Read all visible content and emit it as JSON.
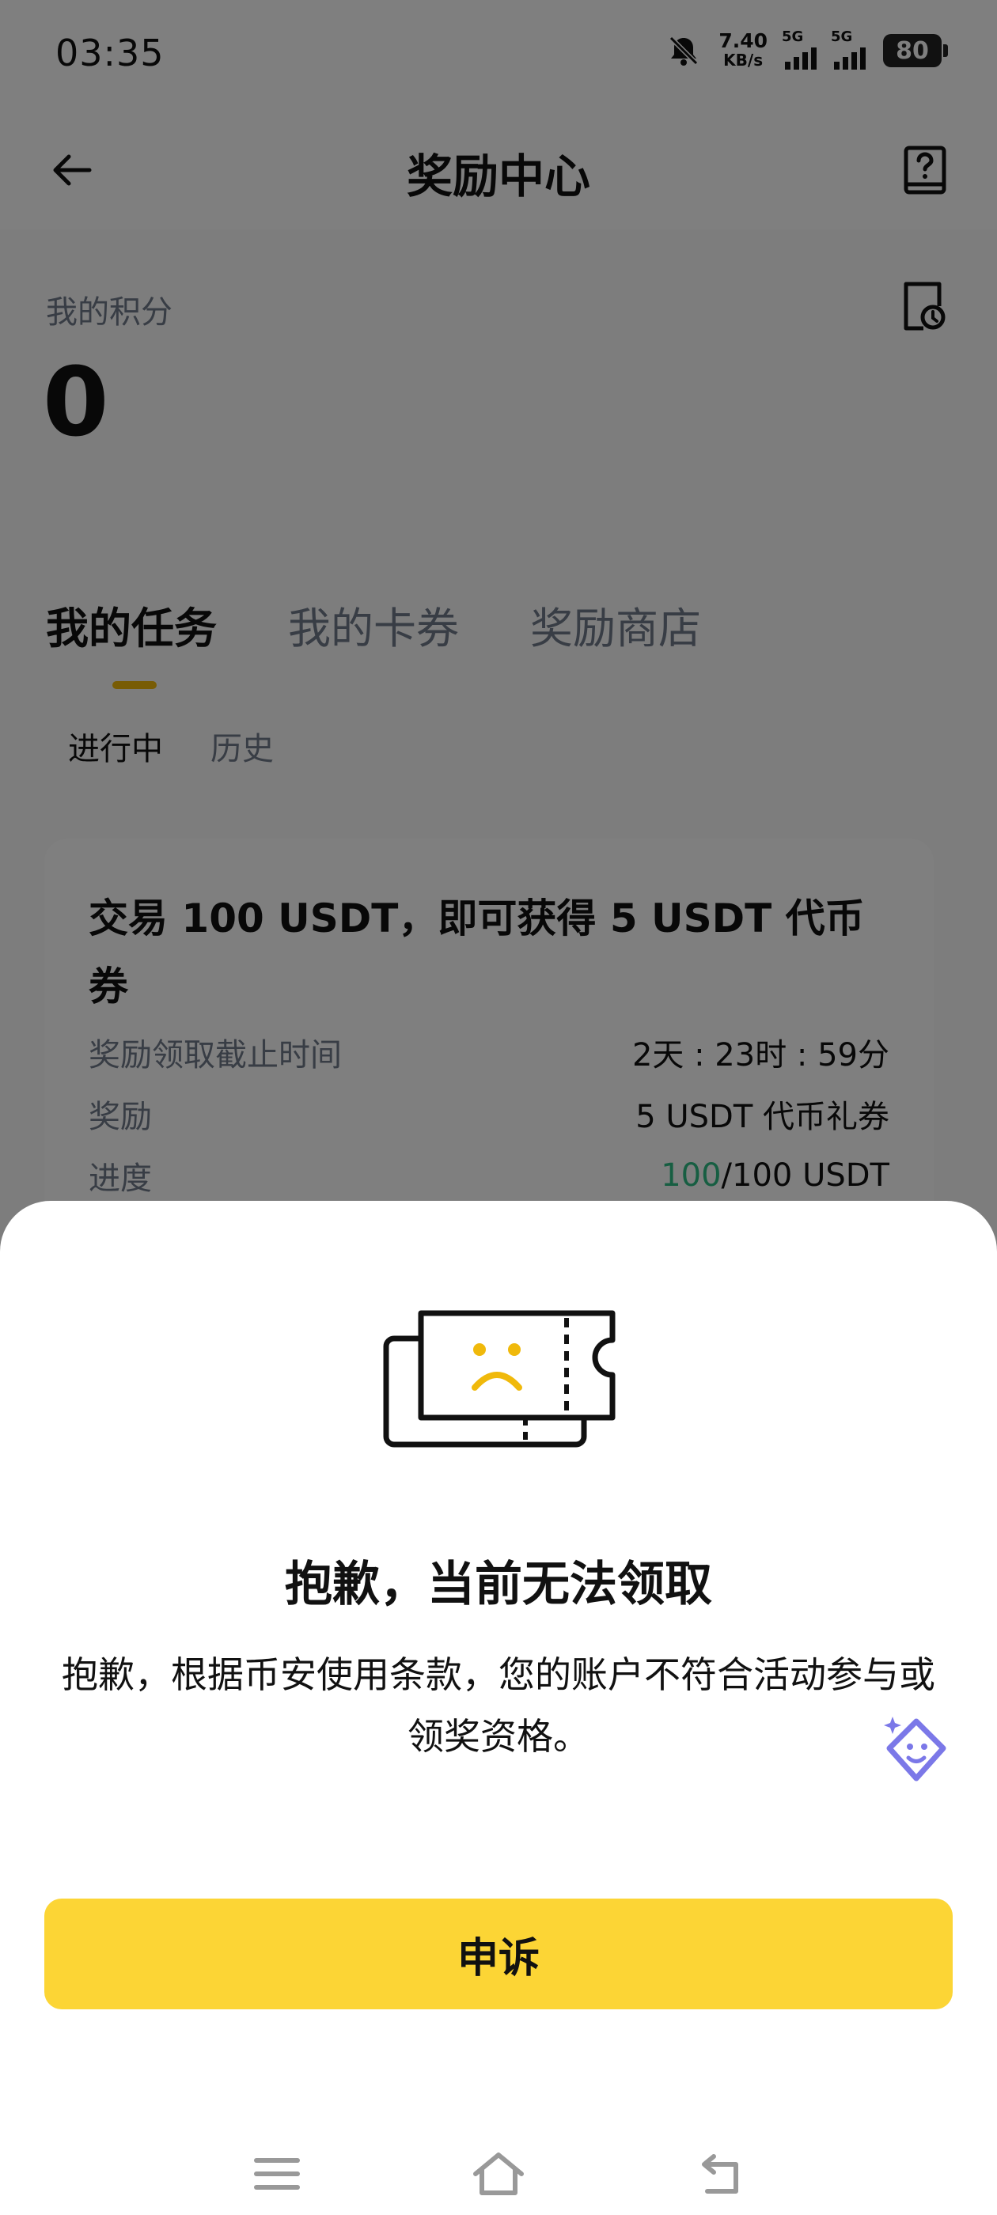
{
  "status_bar": {
    "time": "03:35",
    "net_speed": "7.40",
    "net_unit": "KB/s",
    "sim1": "5G",
    "sim2": "5G",
    "battery": "80"
  },
  "header": {
    "title": "奖励中心"
  },
  "points": {
    "label": "我的积分",
    "value": "0"
  },
  "tabs": [
    {
      "label": "我的任务",
      "active": true
    },
    {
      "label": "我的卡券",
      "active": false
    },
    {
      "label": "奖励商店",
      "active": false
    }
  ],
  "subtabs": [
    {
      "label": "进行中",
      "active": true
    },
    {
      "label": "历史",
      "active": false
    }
  ],
  "task": {
    "title": "交易 100 USDT，即可获得 5 USDT 代币券",
    "deadline_label": "奖励领取截止时间",
    "deadline_value": "2天 : 23时 : 59分",
    "reward_label": "奖励",
    "reward_value": "5 USDT 代币礼券",
    "progress_label": "进度",
    "progress_current": "100",
    "progress_total": "/100 USDT"
  },
  "sheet": {
    "title": "抱歉，当前无法领取",
    "description": "抱歉，根据币安使用条款，您的账户不符合活动参与或领奖资格。",
    "button_label": "申诉"
  },
  "colors": {
    "accent_yellow": "#fcd535",
    "tab_indicator": "#f0b90b",
    "progress_green": "#2ebd85",
    "assistant_purple": "#7b78e8"
  },
  "icons": [
    "back-arrow-icon",
    "help-book-icon",
    "history-clock-icon",
    "sad-ticket-icon",
    "ai-assistant-icon",
    "menu-icon",
    "home-icon",
    "back-nav-icon"
  ]
}
